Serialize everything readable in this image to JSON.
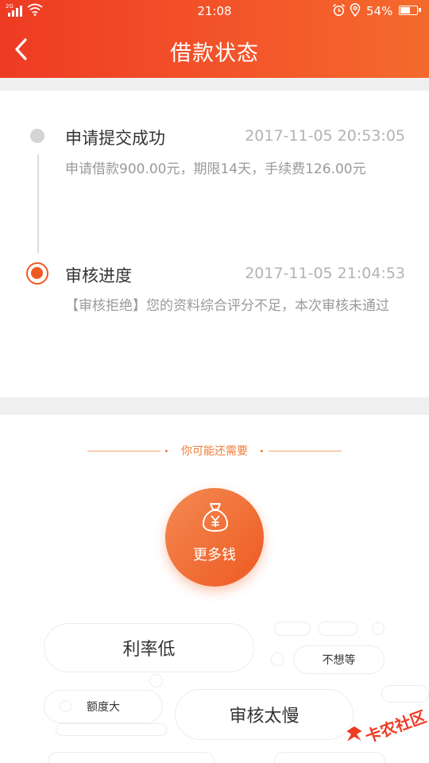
{
  "status_bar": {
    "signal_tag": "2G",
    "time": "21:08",
    "battery": "54%",
    "battery_level": 0.54
  },
  "header": {
    "title": "借款状态"
  },
  "timeline": [
    {
      "title": "申请提交成功",
      "time": "2017-11-05 20:53:05",
      "desc": "申请借款900.00元，期限14天，手续费126.00元",
      "state": "done"
    },
    {
      "title": "审核进度",
      "time": "2017-11-05 21:04:53",
      "desc": "【审核拒绝】您的资料综合评分不足，本次审核未通过",
      "state": "current"
    }
  ],
  "recommend": {
    "section_title": "你可能还需要",
    "main_button": "更多钱",
    "tags": [
      "利率低",
      "不想等",
      "额度大",
      "审核太慢"
    ]
  },
  "watermark": {
    "text": "卡农社区"
  },
  "colors": {
    "accent": "#f05a22",
    "header_start": "#ee3b23",
    "header_end": "#f46a2c"
  }
}
